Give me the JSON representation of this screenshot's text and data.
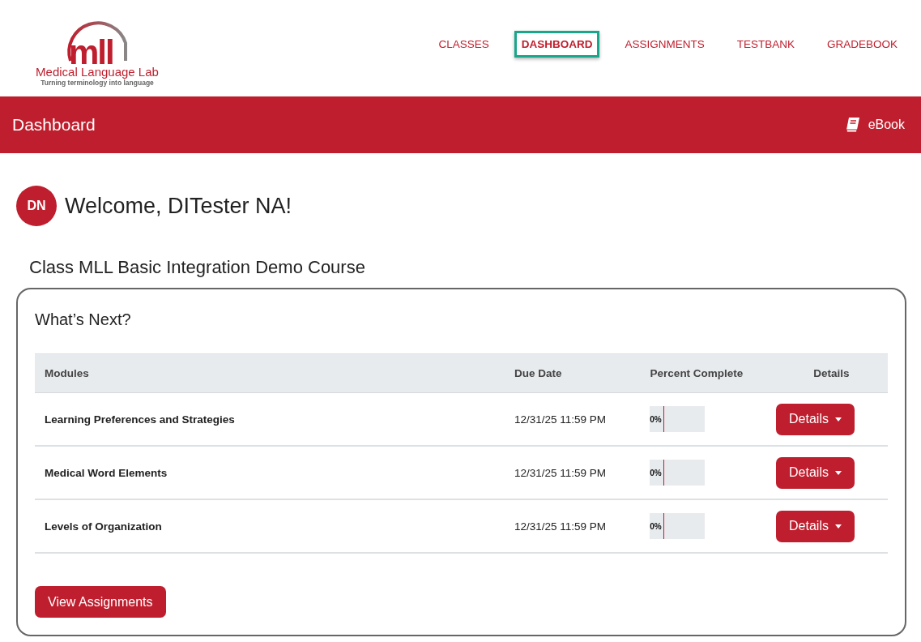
{
  "logo": {
    "mark": "mll",
    "name": "Medical Language Lab",
    "tagline": "Turning terminology into language"
  },
  "nav": [
    {
      "label": "CLASSES",
      "selected": false
    },
    {
      "label": "DASHBOARD",
      "selected": true
    },
    {
      "label": "ASSIGNMENTS",
      "selected": false
    },
    {
      "label": "TESTBANK",
      "selected": false
    },
    {
      "label": "GRADEBOOK",
      "selected": false
    }
  ],
  "banner": {
    "title": "Dashboard",
    "ebook": "eBook"
  },
  "welcome": {
    "initials": "DN",
    "text": "Welcome, DITester NA!"
  },
  "class_title": "Class MLL Basic Integration Demo Course",
  "card": {
    "title": "What’s Next?",
    "columns": [
      "Modules",
      "Due Date",
      "Percent Complete",
      "Details"
    ],
    "rows": [
      {
        "module": "Learning Preferences and Strategies",
        "due": "12/31/25 11:59 PM",
        "level": 0,
        "percent": "0%",
        "button": "Details"
      },
      {
        "module": "Medical Word Elements",
        "due": "12/31/25 11:59 PM",
        "level": 0,
        "percent": "0%",
        "button": "Details"
      },
      {
        "module": "Levels of Organization",
        "due": "12/31/25 11:59 PM",
        "level": 0,
        "percent": "0%",
        "button": "Details"
      }
    ],
    "action": "View Assignments"
  }
}
